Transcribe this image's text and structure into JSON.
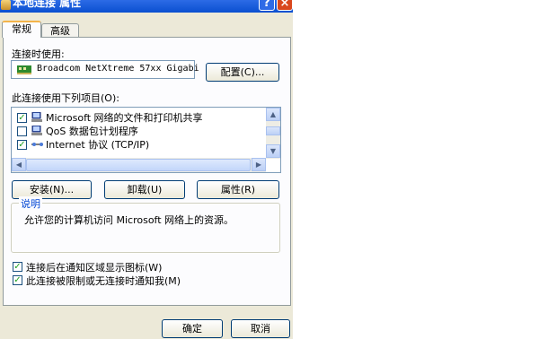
{
  "window": {
    "title": "本地连接 属性",
    "help": "?",
    "close": "×"
  },
  "tabs": [
    {
      "label": "常规"
    },
    {
      "label": "高级"
    }
  ],
  "connect_using": {
    "label": "连接时使用:",
    "adapter": "Broadcom NetXtreme 57xx Gigabi",
    "configure_button": "配置(C)..."
  },
  "items": {
    "label": "此连接使用下列项目(O):",
    "list": [
      {
        "text": "Microsoft 网络的文件和打印机共享",
        "checked": true,
        "icon": "network-client-icon"
      },
      {
        "text": "QoS 数据包计划程序",
        "checked": false,
        "icon": "qos-icon"
      },
      {
        "text": "Internet 协议 (TCP/IP)",
        "checked": true,
        "icon": "protocol-icon"
      }
    ]
  },
  "buttons": {
    "install": "安装(N)...",
    "uninstall": "卸载(U)",
    "properties": "属性(R)"
  },
  "description": {
    "title": "说明",
    "text": "允许您的计算机访问 Microsoft 网络上的资源。"
  },
  "options": {
    "show_icon": {
      "label": "连接后在通知区域显示图标(W)",
      "checked": true
    },
    "notify": {
      "label": "此连接被限制或无连接时通知我(M)",
      "checked": true
    }
  },
  "footer": {
    "ok": "确定",
    "cancel": "取消"
  },
  "colors": {
    "titlebar": "#0a4fd0",
    "dialog_bg": "#ece9d8",
    "panel_bg": "#fcfcfe",
    "group_title": "#0046d5"
  }
}
